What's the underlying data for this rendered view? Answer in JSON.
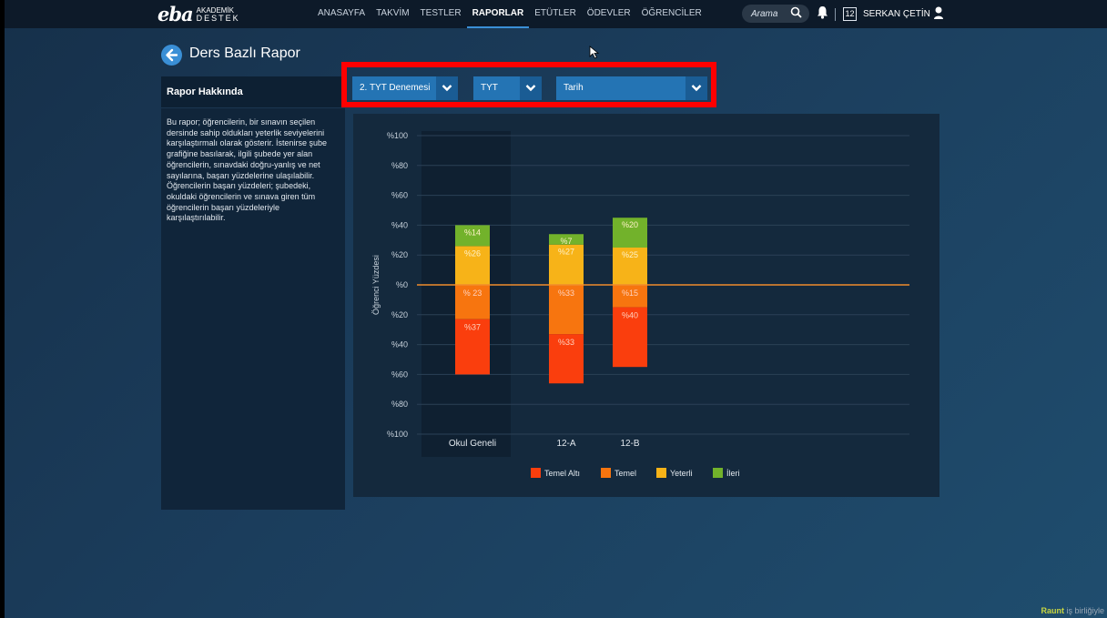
{
  "logo": {
    "main": "eba",
    "top": "AKADEMİK",
    "bottom": "DESTEK"
  },
  "nav": [
    {
      "label": "ANASAYFA"
    },
    {
      "label": "TAKVİM"
    },
    {
      "label": "TESTLER"
    },
    {
      "label": "RAPORLAR",
      "active": true
    },
    {
      "label": "ETÜTLER"
    },
    {
      "label": "ÖDEVLER"
    },
    {
      "label": "ÖĞRENCİLER"
    }
  ],
  "search": {
    "placeholder": "Arama"
  },
  "header": {
    "badge": "12",
    "user": "SERKAN ÇETİN"
  },
  "page": {
    "title": "Ders Bazlı Rapor"
  },
  "sidebar": {
    "title": "Rapor Hakkında",
    "text": "Bu rapor; öğrencilerin, bir sınavın seçilen dersinde sahip oldukları yeterlik seviyelerini karşılaştırmalı olarak gösterir. İstenirse şube grafiğine basılarak, ilgili şubede yer alan öğrencilerin, sınavdaki doğru-yanlış ve net sayılarına, başarı yüzdelerine ulaşılabilir. Öğrencilerin başarı yüzdeleri; şubedeki, okuldaki öğrencilerin ve sınava giren tüm öğrencilerin başarı yüzdeleriyle karşılaştırılabilir."
  },
  "filters": {
    "exam": "2. TYT Denemesi",
    "type": "TYT",
    "date": "Tarih"
  },
  "colors": {
    "temel_alti": "#fa3e0d",
    "temel": "#f7750f",
    "yeterli": "#f7b318",
    "ileri": "#72b22b",
    "zero_line": "#f08c2c",
    "highlight": "#ff0000"
  },
  "chart_data": {
    "type": "bar",
    "stacked": "diverging",
    "ylabel": "Öğrenci Yüzdesi",
    "ylim": [
      -100,
      100
    ],
    "yticks": [
      "%100",
      "%80",
      "%60",
      "%40",
      "%20",
      "%0",
      "%20",
      "%40",
      "%60",
      "%80",
      "%100"
    ],
    "categories": [
      "Okul Geneli",
      "12-A",
      "12-B"
    ],
    "series": [
      {
        "name": "Temel Altı",
        "side": "below",
        "values": [
          37,
          33,
          40
        ],
        "labels": [
          "%37",
          "%33",
          "%40"
        ]
      },
      {
        "name": "Temel",
        "side": "below",
        "values": [
          23,
          33,
          15
        ],
        "labels": [
          "% 23",
          "%33",
          "%15"
        ]
      },
      {
        "name": "Yeterli",
        "side": "above",
        "values": [
          26,
          27,
          25
        ],
        "labels": [
          "%26",
          "%27",
          "%25"
        ]
      },
      {
        "name": "İleri",
        "side": "above",
        "values": [
          14,
          7,
          20
        ],
        "labels": [
          "%14",
          "%7",
          "%20"
        ]
      }
    ],
    "highlighted_category": "Okul Geneli",
    "legend_position": "bottom"
  },
  "watermark": {
    "brand": "Raunt",
    "suffix": "iş birliğiyle"
  }
}
